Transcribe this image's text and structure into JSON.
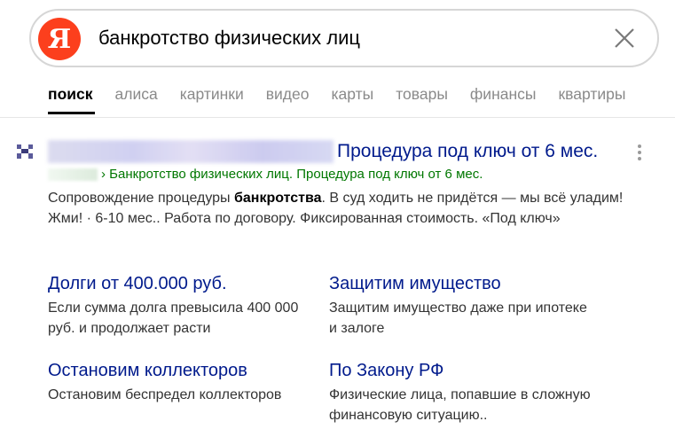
{
  "search": {
    "logo_letter": "Я",
    "query": "банкротство физических лиц"
  },
  "tabs": [
    {
      "label": "поиск",
      "active": true
    },
    {
      "label": "алиса"
    },
    {
      "label": "картинки"
    },
    {
      "label": "видео"
    },
    {
      "label": "карты"
    },
    {
      "label": "товары"
    },
    {
      "label": "финансы"
    },
    {
      "label": "квартиры"
    }
  ],
  "result": {
    "title": "Процедура под ключ от 6 мес.",
    "url_path": "› Банкротство физических лиц. Процедура под ключ от 6 мес.",
    "snippet_before": "Сопровождение процедуры ",
    "snippet_bold": "банкротства",
    "snippet_after": ". В суд ходить не придётся — мы всё уладим! Жми! · 6-10 мес.. Работа по договору. Фиксированная стоимость. «Под ключ»",
    "sitelinks": [
      {
        "title": "Долги от 400.000 руб.",
        "desc": "Если сумма долга превысила 400 000 руб. и продолжает расти"
      },
      {
        "title": "Защитим имущество",
        "desc": "Защитим имущество даже при ипотеке и залоге"
      },
      {
        "title": "Остановим коллекторов",
        "desc": "Остановим беспредел коллекторов"
      },
      {
        "title": "По Закону РФ",
        "desc": "Физические лица, попавшие в сложную финансовую ситуацию.."
      }
    ]
  },
  "colors": {
    "brand_red": "#fc3f1d",
    "link_blue": "#001a8c",
    "url_green": "#007700"
  },
  "icons": {
    "clear": "close-icon",
    "more": "more-vertical-icon",
    "favicon": "site-favicon"
  }
}
